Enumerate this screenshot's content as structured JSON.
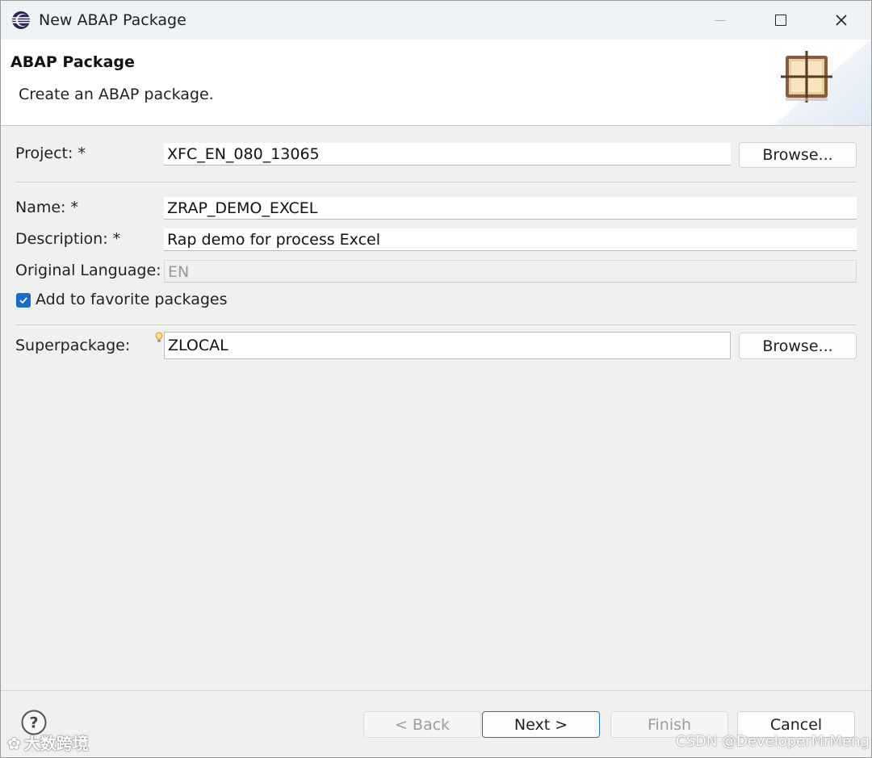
{
  "window": {
    "title": "New ABAP Package",
    "icon": "eclipse-icon"
  },
  "banner": {
    "title": "ABAP Package",
    "description": "Create an ABAP package.",
    "image": "package-wizard-icon"
  },
  "form": {
    "project_label": "Project: *",
    "project_value": "XFC_EN_080_13065",
    "browse_label": "Browse...",
    "name_label": "Name: *",
    "name_value": "ZRAP_DEMO_EXCEL",
    "description_label": "Description: *",
    "description_value": "Rap demo for process Excel",
    "original_language_label": "Original Language:",
    "original_language_value": "EN",
    "favorite_label": "Add to favorite packages",
    "favorite_checked": true,
    "superpackage_label": "Superpackage:",
    "superpackage_value": "ZLOCAL",
    "superpackage_browse_label": "Browse..."
  },
  "footer": {
    "help_icon": "help-icon",
    "back_label": "< Back",
    "next_label": "Next >",
    "finish_label": "Finish",
    "cancel_label": "Cancel"
  },
  "watermarks": {
    "left": "大数跨境",
    "right": "CSDN @DeveloperMrMeng"
  },
  "colors": {
    "accent": "#1a6cc9",
    "default_button_border": "#1f6fbd",
    "background": "#f0f0f0"
  }
}
